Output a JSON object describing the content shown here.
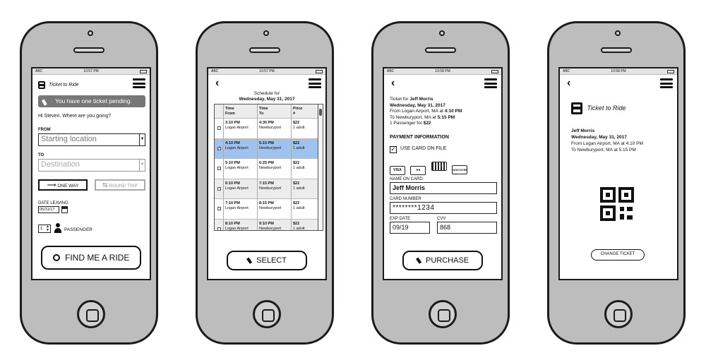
{
  "status": {
    "carrier": "ABC",
    "times": [
      "10:57 PM",
      "10:57 PM",
      "10:58 PM",
      "10:58 PM"
    ]
  },
  "screen1": {
    "app_title": "Ticket to Ride",
    "pending": "You have one ticket pending.",
    "greeting": "Hi Steven. Where are you going?",
    "from_label": "FROM",
    "from_placeholder": "Starting location",
    "to_label": "TO",
    "to_placeholder": "Destination",
    "one_way": "ONE WAY",
    "round_trip": "ROUND TRIP",
    "date_label": "DATE LEAVING",
    "date_value": "05/31/17",
    "passenger_count": "1",
    "passenger_label": "PASSENGER",
    "find_button": "FIND ME A RIDE"
  },
  "screen2": {
    "header_line1": "Schedule for",
    "header_line2": "Wednesday, May 31, 2017",
    "columns": [
      {
        "l1": "Time",
        "l2": "From"
      },
      {
        "l1": "Time",
        "l2": "To"
      },
      {
        "l1": "Price",
        "l2": "#"
      }
    ],
    "rows": [
      {
        "dep": "3:10 PM",
        "from": "Logan Airport",
        "arr": "4:30 PM",
        "to": "Newburyport",
        "price": "$22",
        "qty": "1 adult",
        "checked": false
      },
      {
        "dep": "4:10 PM",
        "from": "Logan Airport",
        "arr": "5:15 PM",
        "to": "Newburyport",
        "price": "$22",
        "qty": "1 adult",
        "checked": true
      },
      {
        "dep": "5:10 PM",
        "from": "Logan Airport",
        "arr": "6:25 PM",
        "to": "Newburyport",
        "price": "$22",
        "qty": "1 adult",
        "checked": false
      },
      {
        "dep": "6:10 PM",
        "from": "Logan Airport",
        "arr": "7:15 PM",
        "to": "Newburyport",
        "price": "$22",
        "qty": "1 adult",
        "checked": false
      },
      {
        "dep": "7:10 PM",
        "from": "Logan Airport",
        "arr": "8:15 PM",
        "to": "Newburyport",
        "price": "$22",
        "qty": "1 adult",
        "checked": false
      },
      {
        "dep": "8:10 PM",
        "from": "Logan Airport",
        "arr": "9:10 PM",
        "to": "Newburyport",
        "price": "$22",
        "qty": "1 adult",
        "checked": false
      }
    ],
    "select_button": "SELECT"
  },
  "screen3": {
    "ticket_for_prefix": "Ticket for ",
    "ticket_for_name": "Jeff Morris",
    "date": "Wednesday, May 31, 2017",
    "from_prefix": "From Logan Airport, MA at ",
    "from_time": "4:10 PM",
    "to_prefix": "To Newburyport, MA at ",
    "to_time": "5:15 PM",
    "pass_prefix": "1 Passenger for ",
    "pass_price": "$22",
    "payment_heading": "PAYMENT INFORMATION",
    "use_card": "USE CARD ON FILE",
    "cards": [
      "VISA",
      "MC",
      "AMEX",
      "DISCOVER"
    ],
    "name_label": "NAME ON CARD",
    "name_value": "Jeff Morris",
    "number_label": "CARD NUMBER",
    "number_value": "********1234",
    "exp_label": "EXP DATE",
    "exp_value": "09/19",
    "cvv_label": "CVV",
    "cvv_value": "868",
    "purchase_button": "PURCHASE"
  },
  "screen4": {
    "app_title": "Ticket to Ride",
    "name": "Jeff Morris",
    "date": "Wednesday, May 31, 2017",
    "from_line": "From Logan Airport, MA at 4:10 PM",
    "to_line": "To Newburyport, MA at 5:15 PM",
    "change_button": "CHANGE TICKET"
  }
}
